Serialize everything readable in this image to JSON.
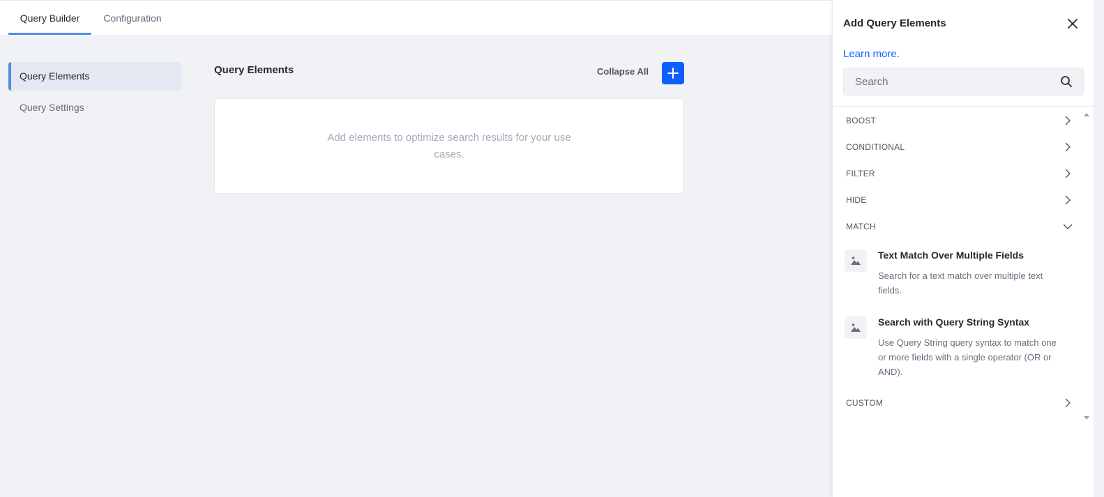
{
  "tabs": [
    {
      "label": "Query Builder",
      "active": true
    },
    {
      "label": "Configuration",
      "active": false
    }
  ],
  "nav": [
    {
      "label": "Query Elements",
      "active": true
    },
    {
      "label": "Query Settings",
      "active": false
    }
  ],
  "main": {
    "title": "Query Elements",
    "collapse_label": "Collapse All",
    "add_icon": "plus-icon",
    "empty_text": "Add elements to optimize search results for your use cases."
  },
  "panel": {
    "title": "Add Query Elements",
    "close_icon": "close-icon",
    "learn_more": "Learn more.",
    "search_placeholder": "Search",
    "search_icon": "search-icon",
    "categories": [
      {
        "label": "BOOST",
        "expanded": false
      },
      {
        "label": "CONDITIONAL",
        "expanded": false
      },
      {
        "label": "FILTER",
        "expanded": false
      },
      {
        "label": "HIDE",
        "expanded": false
      },
      {
        "label": "MATCH",
        "expanded": true
      },
      {
        "label": "CUSTOM",
        "expanded": false
      }
    ],
    "match_elements": [
      {
        "title": "Text Match Over Multiple Fields",
        "description": "Search for a text match over multiple text fields.",
        "icon": "image-icon"
      },
      {
        "title": "Search with Query String Syntax",
        "description": "Use Query String query syntax to match one or more fields with a single operator (OR or AND).",
        "icon": "image-icon"
      }
    ]
  },
  "colors": {
    "accent": "#0b5fff",
    "tab_indicator": "#528ce8",
    "background": "#f1f2f5"
  }
}
